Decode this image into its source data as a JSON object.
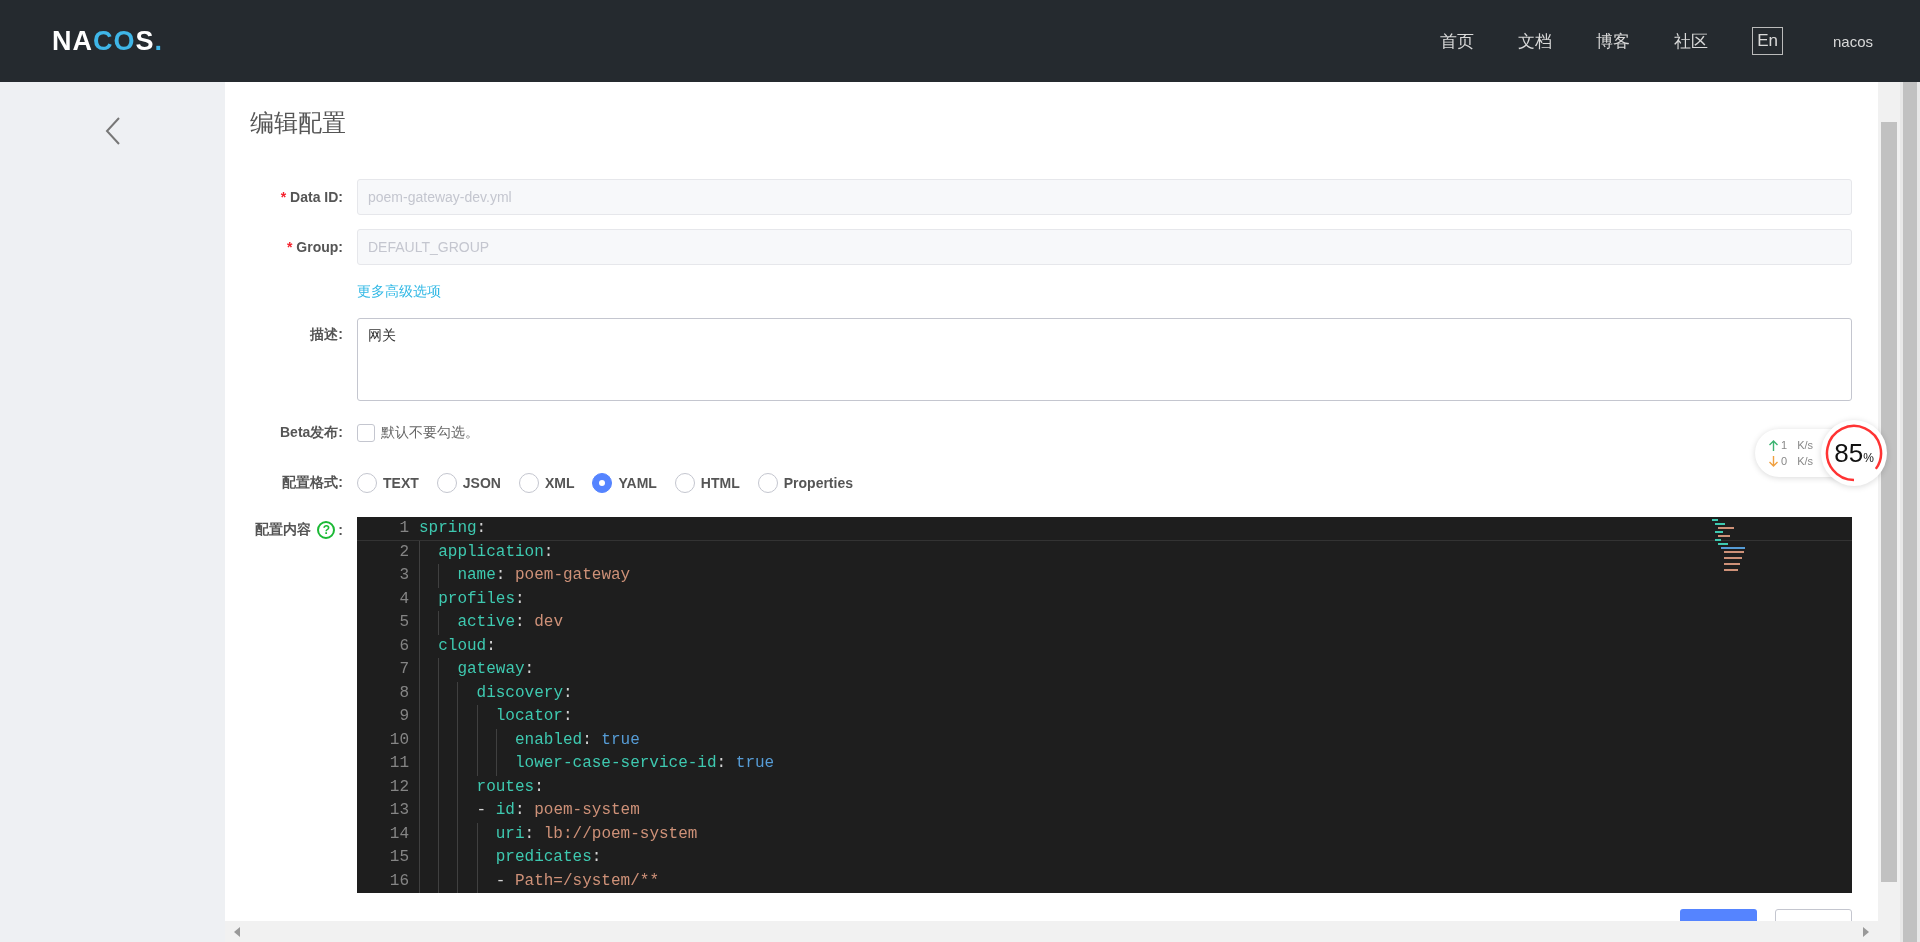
{
  "header": {
    "logo": "NACOS.",
    "nav": [
      {
        "label": "首页"
      },
      {
        "label": "文档"
      },
      {
        "label": "博客"
      },
      {
        "label": "社区"
      }
    ],
    "language": "En",
    "user": "nacos"
  },
  "page": {
    "title": "编辑配置",
    "fields": [
      {
        "required_mark": "*",
        "label": "Data ID:",
        "value": "poem-gateway-dev.yml",
        "disabled": true
      },
      {
        "required_mark": "*",
        "label": "Group:",
        "value": "DEFAULT_GROUP",
        "disabled": true
      }
    ],
    "advanced_link": "更多高级选项",
    "description": {
      "label": "描述:",
      "value": "网关"
    },
    "beta": {
      "label": "Beta发布:",
      "checked": false,
      "text": "默认不要勾选。"
    },
    "format": {
      "label": "配置格式:",
      "options": [
        {
          "label": "TEXT",
          "selected": false
        },
        {
          "label": "JSON",
          "selected": false
        },
        {
          "label": "XML",
          "selected": false
        },
        {
          "label": "YAML",
          "selected": true
        },
        {
          "label": "HTML",
          "selected": false
        },
        {
          "label": "Properties",
          "selected": false
        }
      ]
    },
    "content": {
      "label": "配置内容",
      "help": "?",
      "colon": ":",
      "lines": [
        {
          "number": "1",
          "tokens": [
            {
              "kind": "key",
              "text": "spring"
            },
            {
              "kind": "punct",
              "text": ":"
            }
          ],
          "children": [
            {
              "number": "2",
              "tokens": [
                {
                  "kind": "key",
                  "text": "application"
                },
                {
                  "kind": "punct",
                  "text": ":"
                }
              ],
              "children": [
                {
                  "number": "3",
                  "tokens": [
                    {
                      "kind": "key",
                      "text": "name"
                    },
                    {
                      "kind": "punct",
                      "text": ": "
                    },
                    {
                      "kind": "string",
                      "text": "poem-gateway"
                    }
                  ]
                }
              ]
            },
            {
              "number": "4",
              "tokens": [
                {
                  "kind": "key",
                  "text": "profiles"
                },
                {
                  "kind": "punct",
                  "text": ":"
                }
              ],
              "children": [
                {
                  "number": "5",
                  "tokens": [
                    {
                      "kind": "key",
                      "text": "active"
                    },
                    {
                      "kind": "punct",
                      "text": ": "
                    },
                    {
                      "kind": "string",
                      "text": "dev"
                    }
                  ]
                }
              ]
            },
            {
              "number": "6",
              "tokens": [
                {
                  "kind": "key",
                  "text": "cloud"
                },
                {
                  "kind": "punct",
                  "text": ":"
                }
              ],
              "children": [
                {
                  "number": "7",
                  "tokens": [
                    {
                      "kind": "key",
                      "text": "gateway"
                    },
                    {
                      "kind": "punct",
                      "text": ":"
                    }
                  ],
                  "children": [
                    {
                      "number": "8",
                      "tokens": [
                        {
                          "kind": "key",
                          "text": "discovery"
                        },
                        {
                          "kind": "punct",
                          "text": ":"
                        }
                      ],
                      "children": [
                        {
                          "number": "9",
                          "tokens": [
                            {
                              "kind": "key",
                              "text": "locator"
                            },
                            {
                              "kind": "punct",
                              "text": ":"
                            }
                          ],
                          "children": [
                            {
                              "number": "10",
                              "tokens": [
                                {
                                  "kind": "key",
                                  "text": "enabled"
                                },
                                {
                                  "kind": "punct",
                                  "text": ": "
                                },
                                {
                                  "kind": "bool",
                                  "text": "true"
                                }
                              ]
                            },
                            {
                              "number": "11",
                              "tokens": [
                                {
                                  "kind": "key",
                                  "text": "lower-case-service-id"
                                },
                                {
                                  "kind": "punct",
                                  "text": ": "
                                },
                                {
                                  "kind": "bool",
                                  "text": "true"
                                }
                              ]
                            }
                          ]
                        }
                      ]
                    },
                    {
                      "number": "12",
                      "tokens": [
                        {
                          "kind": "key",
                          "text": "routes"
                        },
                        {
                          "kind": "punct",
                          "text": ":"
                        }
                      ]
                    },
                    {
                      "number": "13",
                      "tokens": [
                        {
                          "kind": "punct",
                          "text": "- "
                        },
                        {
                          "kind": "key",
                          "text": "id"
                        },
                        {
                          "kind": "punct",
                          "text": ": "
                        },
                        {
                          "kind": "string",
                          "text": "poem-system"
                        }
                      ],
                      "children": [
                        {
                          "number": "14",
                          "tokens": [
                            {
                              "kind": "key",
                              "text": "uri"
                            },
                            {
                              "kind": "punct",
                              "text": ": "
                            },
                            {
                              "kind": "string",
                              "text": "lb://poem-system"
                            }
                          ]
                        },
                        {
                          "number": "15",
                          "tokens": [
                            {
                              "kind": "key",
                              "text": "predicates"
                            },
                            {
                              "kind": "punct",
                              "text": ":"
                            }
                          ]
                        },
                        {
                          "number": "16",
                          "tokens": [
                            {
                              "kind": "punct",
                              "text": "- "
                            },
                            {
                              "kind": "string",
                              "text": "Path=/system/**"
                            }
                          ]
                        }
                      ]
                    }
                  ]
                }
              ]
            }
          ]
        }
      ]
    }
  },
  "speed_widget": {
    "up": "1",
    "down": "0",
    "unit_up": "K/s",
    "unit_down": "K/s",
    "percent": "85",
    "percent_sign": "%"
  }
}
